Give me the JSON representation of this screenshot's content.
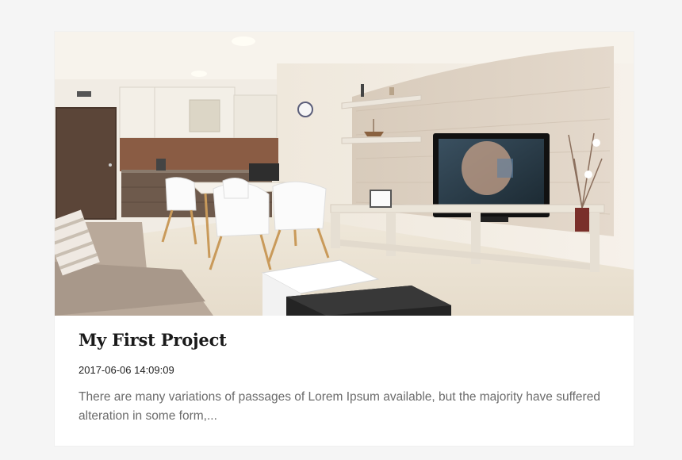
{
  "post": {
    "title": "My First Project",
    "date": "2017-06-06 14:09:09",
    "excerpt": "There are many variations of passages of Lorem Ipsum available, but the majority have suffered alteration in some form,..."
  },
  "colors": {
    "page_background": "#f5f5f5",
    "card_background": "#ffffff",
    "title": "#1a1a1a",
    "excerpt": "#6b6b6b"
  }
}
